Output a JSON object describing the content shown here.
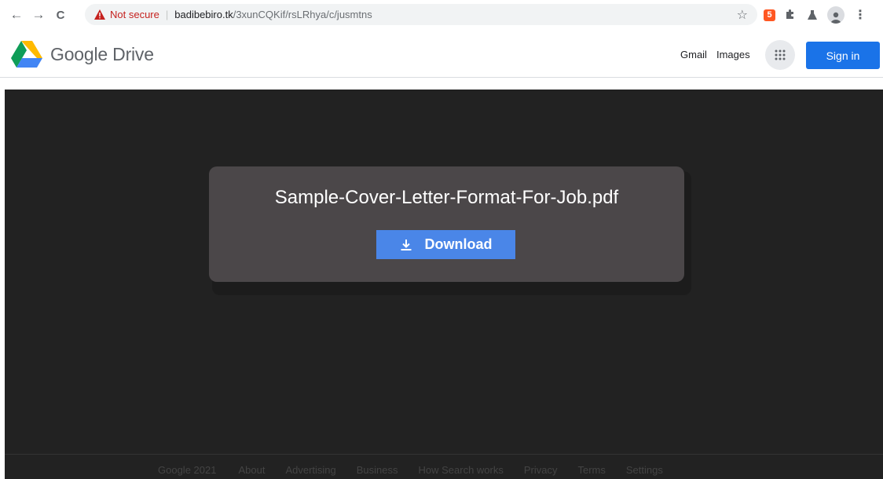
{
  "browser": {
    "nav": {
      "back_icon": "←",
      "forward_icon": "→",
      "reload_icon": "C"
    },
    "omnibox": {
      "security_label": "Not secure",
      "separator": "|",
      "url_host": "badibebiro.tk",
      "url_path": "/3xunCQKif/rsLRhya/c/jusmtns"
    },
    "star_icon": "☆",
    "extension_badge": "5",
    "menu_icon": "⋮"
  },
  "header": {
    "brand": "Google Drive",
    "links": {
      "gmail": "Gmail",
      "images": "Images"
    },
    "sign_in": "Sign in"
  },
  "card": {
    "file_name": "Sample-Cover-Letter-Format-For-Job.pdf",
    "download_label": "Download"
  },
  "footer": {
    "copyright": "Google 2021",
    "links": [
      "About",
      "Advertising",
      "Business",
      "How Search works",
      "Privacy",
      "Terms",
      "Settings"
    ]
  },
  "colors": {
    "accent_blue": "#1a73e8",
    "download_blue": "#4a86e8",
    "dark_bg": "#222222",
    "card_bg": "#4b4749",
    "warning_red": "#c5221f"
  }
}
